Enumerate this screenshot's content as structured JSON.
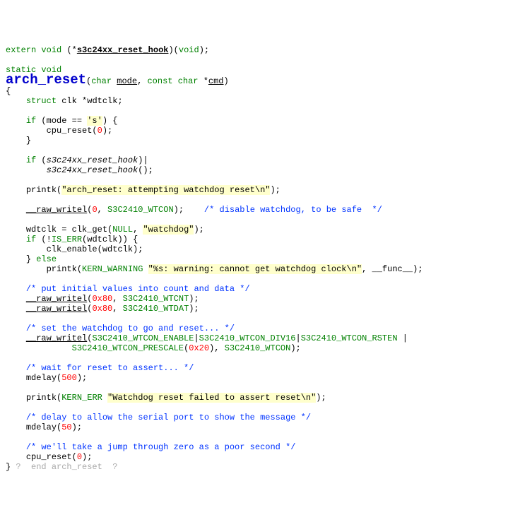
{
  "code": {
    "l1": {
      "extern": "extern",
      "void1": "void",
      "star": "(*",
      "hook": "s3c24xx_reset_hook",
      "close": ")(",
      "void2": "void",
      "end": ");"
    },
    "l3": {
      "static": "static",
      "void": "void"
    },
    "l4": {
      "name": "arch_reset",
      "open": "(",
      "char": "char",
      "sp": " ",
      "mode": "mode",
      "comma": ", ",
      "const": "const",
      "char2": "char",
      "star": " *",
      "cmd": "cmd",
      "close": ")"
    },
    "l5": "{",
    "l6": {
      "struct": "struct",
      "clk": "clk",
      "var": " *wdtclk;"
    },
    "l8": {
      "if": "if",
      "open": " (mode == ",
      "lit": "'s'",
      "close": ") {"
    },
    "l9": {
      "call": "cpu_reset",
      "open": "(",
      "zero": "0",
      "close": ");"
    },
    "l10": "}",
    "l12": {
      "if": "if",
      "open": " (",
      "it": "s3c24xx_reset_hook",
      "close": ")",
      "caret": "|"
    },
    "l13": {
      "it": "s3c24xx_reset_hook",
      "call": "();"
    },
    "l15": {
      "fn": "printk",
      "open": "(",
      "s": "\"arch_reset: attempting watchdog reset\\n\"",
      "close": ");"
    },
    "l17": {
      "fn": "__raw_writel",
      "open": "(",
      "zero": "0",
      "comma": ", ",
      "m": "S3C2410_WTCON",
      "close": ");",
      "gap": "    ",
      "c": "/* disable watchdog, to be safe  */"
    },
    "l19": {
      "var": "wdtclk = ",
      "fn": "clk_get",
      "open": "(",
      "null": "NULL",
      "comma": ", ",
      "s": "\"watchdog\"",
      "close": ");"
    },
    "l20": {
      "if": "if",
      "open": " (!",
      "m": "IS_ERR",
      "p1": "(wdtclk)) {"
    },
    "l21": {
      "fn": "clk_enable",
      "args": "(wdtclk);"
    },
    "l22": {
      "close": "} ",
      "else": "else"
    },
    "l23": {
      "fn": "printk",
      "open": "(",
      "m": "KERN_WARNING",
      "sp": " ",
      "s": "\"%s: warning: cannot get watchdog clock\\n\"",
      "comma": ", __func__);"
    },
    "l25": "/* put initial values into count and data */",
    "l26": {
      "fn": "__raw_writel",
      "open": "(",
      "n": "0x80",
      "c": ", ",
      "m": "S3C2410_WTCNT",
      "close": ");"
    },
    "l27": {
      "fn": "__raw_writel",
      "open": "(",
      "n": "0x80",
      "c": ", ",
      "m": "S3C2410_WTDAT",
      "close": ");"
    },
    "l29": "/* set the watchdog to go and reset... */",
    "l30": {
      "fn": "__raw_writel",
      "open": "(",
      "m1": "S3C2410_WTCON_ENABLE",
      "p1": "|",
      "m2": "S3C2410_WTCON_DIV16",
      "p2": "|",
      "m3": "S3C2410_WTCON_RSTEN",
      "p3": " |"
    },
    "l31": {
      "m4": "S3C2410_WTCON_PRESCALE",
      "open": "(",
      "n": "0x20",
      "close": "), ",
      "m5": "S3C2410_WTCON",
      "end": ");"
    },
    "l33": "/* wait for reset to assert... */",
    "l34": {
      "fn": "mdelay",
      "open": "(",
      "n": "500",
      "close": ");"
    },
    "l36": {
      "fn": "printk",
      "open": "(",
      "m": "KERN_ERR",
      "sp": " ",
      "s": "\"Watchdog reset failed to assert reset\\n\"",
      "close": ");"
    },
    "l38": "/* delay to allow the serial port to show the message */",
    "l39": {
      "fn": "mdelay",
      "open": "(",
      "n": "50",
      "close": ");"
    },
    "l41": "/* we'll take a jump through zero as a poor second */",
    "l42": {
      "fn": "cpu_reset",
      "open": "(",
      "n": "0",
      "close": ");"
    },
    "l43": {
      "brace": "} ",
      "q1": "?",
      "text": "  end arch_reset  ",
      "q2": "?"
    }
  }
}
